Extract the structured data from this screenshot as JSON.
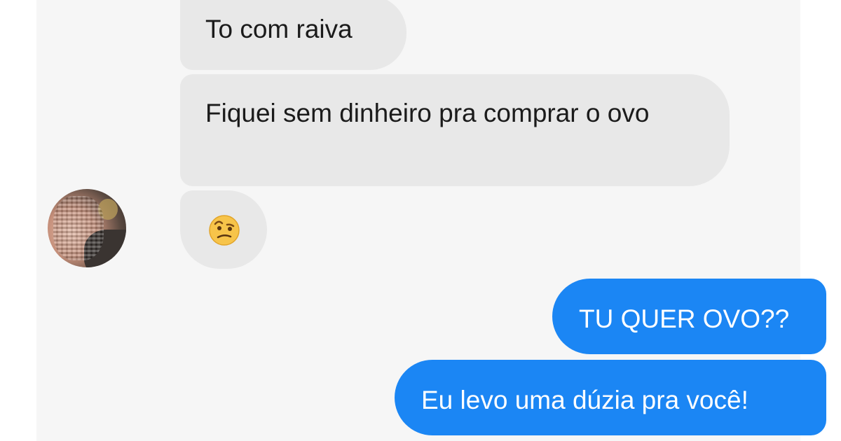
{
  "conversation": {
    "incoming": [
      {
        "text": "To com raiva"
      },
      {
        "text": "Fiquei sem dinheiro pra comprar o ovo"
      },
      {
        "emoji": "face-with-raised-eyebrow-icon"
      }
    ],
    "outgoing": [
      {
        "text": "TU QUER OVO??"
      },
      {
        "text": "Eu levo uma dúzia pra você!"
      }
    ]
  },
  "colors": {
    "incoming_bubble": "#e8e8e8",
    "outgoing_bubble": "#1b86f4",
    "background": "#f6f6f6"
  }
}
